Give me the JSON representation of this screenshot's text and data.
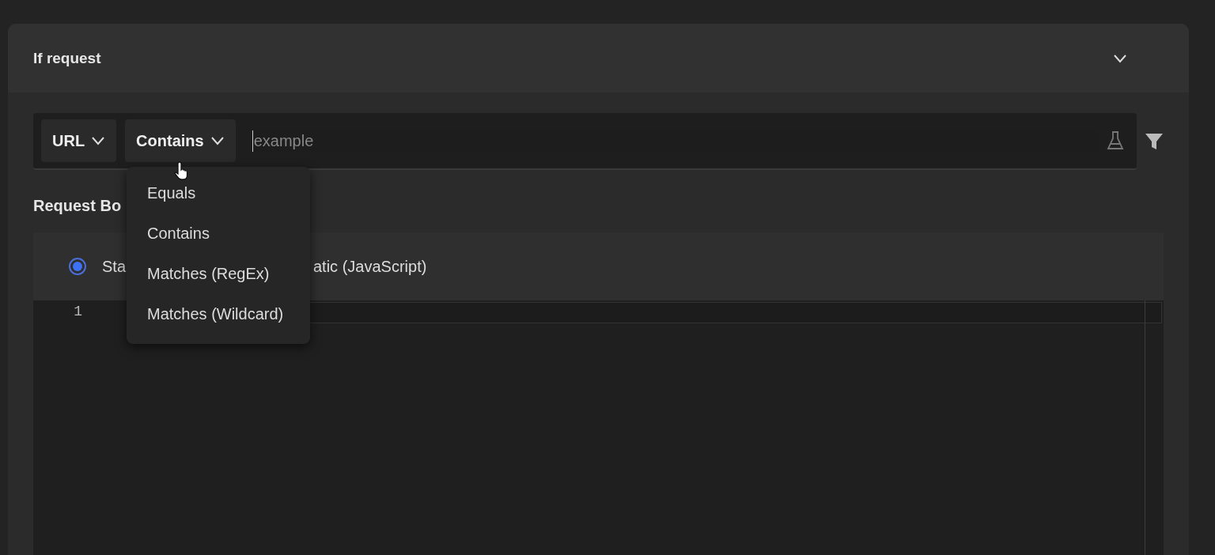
{
  "request_section": {
    "title": "If request",
    "expanded": true
  },
  "filter": {
    "field": "URL",
    "operator": "Contains",
    "placeholder": "example"
  },
  "operator_menu": {
    "items": [
      {
        "label": "Equals",
        "selected": false
      },
      {
        "label": "Contains",
        "selected": false
      },
      {
        "label": "Matches (RegEx)",
        "selected": false
      },
      {
        "label": "Matches (Wildcard)",
        "selected": false
      }
    ]
  },
  "request_body": {
    "label": "Request Bo",
    "mode": {
      "label": "Sta",
      "selected": true
    },
    "other_mode_label": "atic (JavaScript)"
  },
  "editor": {
    "line_numbers": [
      "1"
    ]
  }
}
